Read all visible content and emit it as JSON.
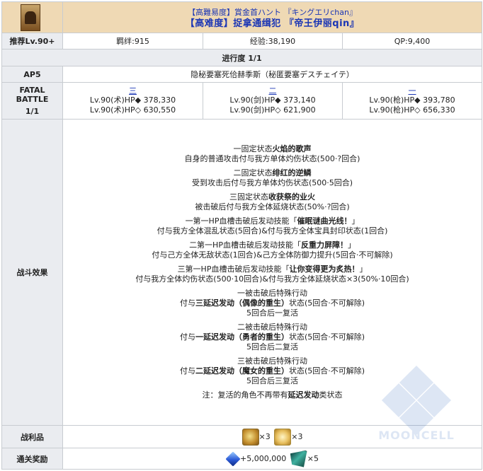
{
  "header": {
    "line1": "【高難易度】賞金首ハント 『キングエリchan』",
    "line2": "【高难度】捉拿通缉犯 『帝王伊丽qin』"
  },
  "recommend": {
    "label": "推荐Lv.90+",
    "bond": "羁绊:915",
    "exp": "经验:38,190",
    "qp": "QP:9,400"
  },
  "progress": "进行度 1/1",
  "ap": {
    "label": "AP5",
    "value": "隐秘要塞死佮赫季斯（秘匿要塞デスチェイテ）"
  },
  "battle": {
    "label_line1": "FATAL BATTLE",
    "label_line2": "1/1",
    "enemies": [
      {
        "name": "三",
        "line1": "Lv.90(术)HP◆ 378,330",
        "line2": "Lv.90(术)HP◇ 630,550"
      },
      {
        "name": "二",
        "line1": "Lv.90(剑)HP◆ 373,140",
        "line2": "Lv.90(剑)HP◇ 621,900"
      },
      {
        "name": "一",
        "line1": "Lv.90(枪)HP◆ 393,780",
        "line2": "Lv.90(枪)HP◇ 656,330"
      }
    ]
  },
  "effects": {
    "label": "战斗效果",
    "blocks": [
      {
        "pre": "一固定状态",
        "bold": "火焰的歌声",
        "post": "",
        "line2": "自身的普通攻击付与我方单体灼伤状态(500·?回合)"
      },
      {
        "pre": "二固定状态",
        "bold": "绯红的逆鳞",
        "post": "",
        "line2": "受到攻击后付与我方单体灼伤状态(500·5回合)"
      },
      {
        "pre": "三固定状态",
        "bold": "收获祭的业火",
        "post": "",
        "line2": "被击破后付与我方全体延烧状态(50%·?回合)"
      },
      {
        "pre": "一第一HP血槽击破后发动技能「",
        "bold": "催眠谜曲光线！",
        "post": "」",
        "line2": "付与我方全体混乱状态(5回合)&付与我方全体宝具封印状态(1回合)"
      },
      {
        "pre": "二第一HP血槽击破后发动技能「",
        "bold": "反重力屏障！",
        "post": "」",
        "line2": "付与己方全体无敌状态(1回合)&己方全体防御力提升(5回合·不可解除)"
      },
      {
        "pre": "三第一HP血槽击破后发动技能「",
        "bold": "让你变得更为炙热！",
        "post": "」",
        "line2": "付与我方全体灼伤状态(500·10回合)&付与我方全体延烧状态×3(50%·10回合)"
      }
    ],
    "revive": [
      {
        "line1": "一被击破后特殊行动",
        "pre": "付与",
        "bold": "三延迟发动（偶像的重生）",
        "post": "状态(5回合·不可解除)",
        "line3": "5回合后一复活"
      },
      {
        "line1": "二被击破后特殊行动",
        "pre": "付与",
        "bold": "一延迟发动（勇者的重生）",
        "post": "状态(5回合·不可解除)",
        "line3": "5回合后二复活"
      },
      {
        "line1": "三被击破后特殊行动",
        "pre": "付与",
        "bold": "二延迟发动（魔女的重生）",
        "post": "状态(5回合·不可解除)",
        "line3": "5回合后三复活"
      }
    ],
    "note_pre": "注：复活的角色不再带有",
    "note_bold": "延迟发动",
    "note_post": "类状态"
  },
  "drops": {
    "label": "战利品",
    "items": [
      {
        "icon": "golden-egg-icon",
        "count": "×3"
      },
      {
        "icon": "golden-leaf-icon",
        "count": "×3"
      }
    ]
  },
  "rewards": {
    "label": "通关奖励",
    "items": [
      {
        "icon": "qp-crystal-icon",
        "count": "+5,000,000"
      },
      {
        "icon": "ex-material-icon",
        "count": "×5"
      }
    ]
  },
  "watermark": "MOONCELL",
  "colors": {
    "title": "#1a35b5",
    "header_bg": "#efd9b4",
    "label_bg": "#eaecf0"
  }
}
